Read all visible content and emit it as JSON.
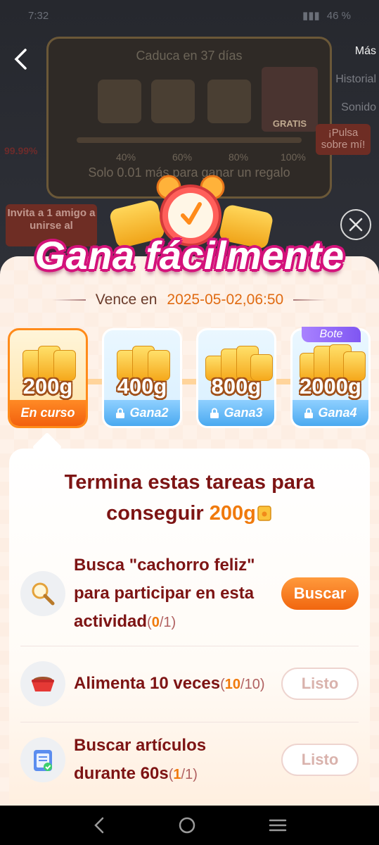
{
  "status_bar": {
    "time": "7:32",
    "battery": "46 %"
  },
  "background_app": {
    "more_label": "Más",
    "history_label": "Historial",
    "sound_label": "Sonido",
    "expire_text": "Caduca en 37 días",
    "free_label": "GRATIS",
    "current_percent": "99.99%",
    "progress_steps": [
      "40%",
      "60%",
      "80%",
      "100%"
    ],
    "subtext": "Solo 0.01 más para ganar un regalo",
    "invite_text": "Invita a 1 amigo a unirse al",
    "pulse_text": "¡Pulsa sobre mí!"
  },
  "modal": {
    "title": "Gana fácilmente",
    "expire_label": "Vence en",
    "expire_date": "2025-05-02,06:50",
    "tiers": [
      {
        "amount": "200g",
        "label": "En curso",
        "state": "active"
      },
      {
        "amount": "400g",
        "label": "Gana2",
        "state": "locked"
      },
      {
        "amount": "800g",
        "label": "Gana3",
        "state": "locked"
      },
      {
        "amount": "2000g",
        "label": "Gana4",
        "state": "locked",
        "badge": "Bote"
      }
    ],
    "tasks_title_line1": "Termina estas tareas para",
    "tasks_title_prefix": "conseguir",
    "tasks_title_amount": "200g",
    "tasks": [
      {
        "icon": "magnifier-icon",
        "text": "Busca \"cachorro feliz\" para participar en esta actividad",
        "done": "0",
        "total": "1",
        "button": "Buscar",
        "button_state": "primary"
      },
      {
        "icon": "pet-bowl-icon",
        "text": "Alimenta 10 veces",
        "done": "10",
        "total": "10",
        "button": "Listo",
        "button_state": "done"
      },
      {
        "icon": "clipboard-check-icon",
        "text": "Buscar artículos durante 60s",
        "done": "1",
        "total": "1",
        "button": "Listo",
        "button_state": "done"
      }
    ]
  },
  "colors": {
    "accent": "#f1660f",
    "title_stroke": "#d4127b",
    "task_text": "#7d1414",
    "locked_tier": "#4aa9f0"
  }
}
